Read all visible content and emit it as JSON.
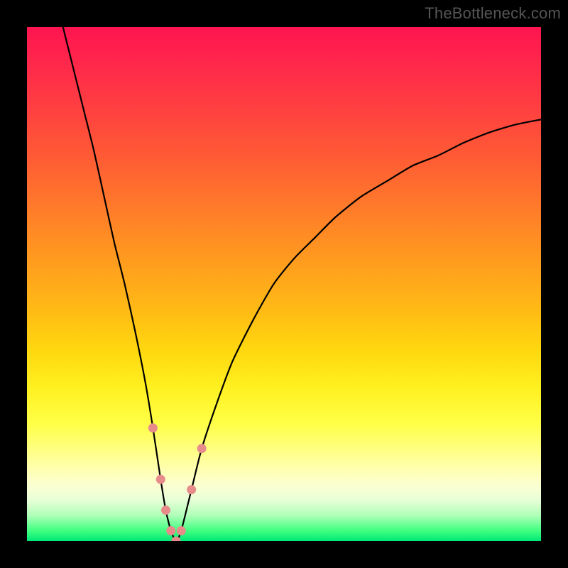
{
  "watermark": "TheBottleneck.com",
  "domain": "Chart",
  "chart_data": {
    "type": "line",
    "title": "",
    "xlabel": "",
    "ylabel": "",
    "xlim": [
      0,
      100
    ],
    "ylim": [
      0,
      100
    ],
    "x": [
      7,
      9,
      11,
      13,
      15,
      17,
      19,
      21,
      23,
      24.5,
      26,
      27,
      28,
      29,
      30,
      32,
      34,
      37,
      40,
      44,
      48,
      52,
      56,
      60,
      65,
      70,
      75,
      80,
      85,
      90,
      95,
      100
    ],
    "values": [
      100,
      92,
      84,
      76,
      67,
      58,
      50,
      41,
      31,
      22,
      12,
      6,
      2,
      0,
      2,
      10,
      18,
      27,
      35,
      43,
      50,
      55,
      59,
      63,
      67,
      70,
      73,
      75,
      77.5,
      79.5,
      81,
      82
    ],
    "minimum_x": 29,
    "markers_x": [
      24.5,
      26,
      27,
      28,
      29,
      30,
      32,
      34
    ],
    "markers_y": [
      22,
      12,
      6,
      2,
      0,
      2,
      10,
      18
    ],
    "gradient_bands": [
      {
        "pos": 0,
        "color": "#ff1450"
      },
      {
        "pos": 35,
        "color": "#ff7a2a"
      },
      {
        "pos": 63,
        "color": "#ffd80f"
      },
      {
        "pos": 80,
        "color": "#ffff70"
      },
      {
        "pos": 95,
        "color": "#b0ffb8"
      },
      {
        "pos": 100,
        "color": "#00e878"
      }
    ],
    "description": "V-shaped bottleneck curve over a vertical red→orange→yellow→green gradient. Curve falls steeply from upper-left, bottoms out near x≈29 at y≈0, then rises with a flattening slope toward the right edge at y≈82. A small cluster of salmon markers surrounds the minimum."
  }
}
